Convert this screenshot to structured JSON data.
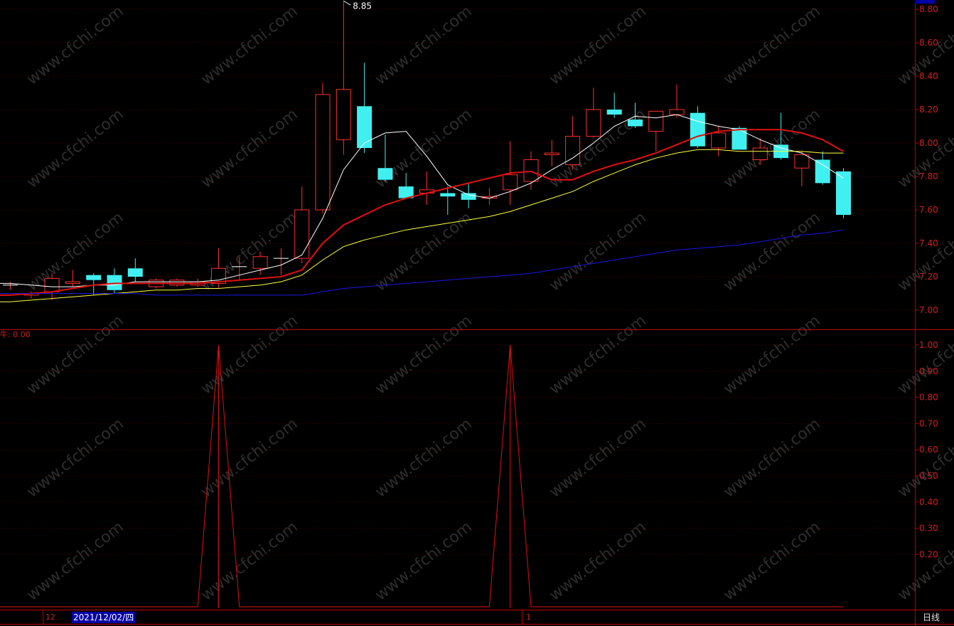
{
  "chart_data": [
    {
      "type": "candlestick",
      "panel": "price",
      "ylim": [
        7.05,
        8.86
      ],
      "y_ticks": [
        "8.80",
        "8.60",
        "8.40",
        "8.20",
        "8.00",
        "7.80",
        "7.60",
        "7.40",
        "7.20",
        "7.00"
      ],
      "high_annotation": "8.85",
      "candles": [
        {
          "o": 7.15,
          "h": 7.17,
          "l": 7.12,
          "c": 7.15
        },
        {
          "o": 7.09,
          "h": 7.11,
          "l": 7.07,
          "c": 7.1
        },
        {
          "o": 7.11,
          "h": 7.22,
          "l": 7.06,
          "c": 7.19
        },
        {
          "o": 7.16,
          "h": 7.24,
          "l": 7.14,
          "c": 7.17
        },
        {
          "o": 7.21,
          "h": 7.22,
          "l": 7.09,
          "c": 7.18
        },
        {
          "o": 7.21,
          "h": 7.25,
          "l": 7.1,
          "c": 7.12
        },
        {
          "o": 7.25,
          "h": 7.31,
          "l": 7.17,
          "c": 7.2
        },
        {
          "o": 7.14,
          "h": 7.19,
          "l": 7.13,
          "c": 7.18
        },
        {
          "o": 7.15,
          "h": 7.19,
          "l": 7.14,
          "c": 7.18
        },
        {
          "o": 7.15,
          "h": 7.19,
          "l": 7.14,
          "c": 7.17
        },
        {
          "o": 7.16,
          "h": 7.37,
          "l": 7.13,
          "c": 7.25
        },
        {
          "o": 7.26,
          "h": 7.32,
          "l": 7.18,
          "c": 7.26
        },
        {
          "o": 7.25,
          "h": 7.35,
          "l": 7.21,
          "c": 7.32
        },
        {
          "o": 7.31,
          "h": 7.37,
          "l": 7.21,
          "c": 7.31
        },
        {
          "o": 7.31,
          "h": 7.74,
          "l": 7.28,
          "c": 7.6
        },
        {
          "o": 7.6,
          "h": 8.36,
          "l": 7.58,
          "c": 8.29
        },
        {
          "o": 8.02,
          "h": 8.85,
          "l": 7.93,
          "c": 8.32
        },
        {
          "o": 8.22,
          "h": 8.48,
          "l": 7.94,
          "c": 7.97
        },
        {
          "o": 7.85,
          "h": 8.05,
          "l": 7.77,
          "c": 7.78
        },
        {
          "o": 7.74,
          "h": 7.82,
          "l": 7.67,
          "c": 7.67
        },
        {
          "o": 7.7,
          "h": 7.83,
          "l": 7.63,
          "c": 7.72
        },
        {
          "o": 7.7,
          "h": 7.74,
          "l": 7.57,
          "c": 7.68
        },
        {
          "o": 7.7,
          "h": 7.76,
          "l": 7.61,
          "c": 7.66
        },
        {
          "o": 7.67,
          "h": 7.73,
          "l": 7.63,
          "c": 7.68
        },
        {
          "o": 7.72,
          "h": 8.01,
          "l": 7.63,
          "c": 7.81
        },
        {
          "o": 7.77,
          "h": 7.95,
          "l": 7.72,
          "c": 7.9
        },
        {
          "o": 7.93,
          "h": 8.02,
          "l": 7.86,
          "c": 7.94
        },
        {
          "o": 7.87,
          "h": 8.16,
          "l": 7.84,
          "c": 8.04
        },
        {
          "o": 8.04,
          "h": 8.33,
          "l": 8.03,
          "c": 8.2
        },
        {
          "o": 8.2,
          "h": 8.3,
          "l": 8.15,
          "c": 8.17
        },
        {
          "o": 8.14,
          "h": 8.24,
          "l": 8.09,
          "c": 8.1
        },
        {
          "o": 8.07,
          "h": 8.19,
          "l": 7.95,
          "c": 8.19
        },
        {
          "o": 8.17,
          "h": 8.35,
          "l": 8.15,
          "c": 8.2
        },
        {
          "o": 8.18,
          "h": 8.22,
          "l": 7.97,
          "c": 7.98
        },
        {
          "o": 7.97,
          "h": 8.1,
          "l": 7.92,
          "c": 8.06
        },
        {
          "o": 8.09,
          "h": 8.1,
          "l": 7.96,
          "c": 7.96
        },
        {
          "o": 7.9,
          "h": 8.03,
          "l": 7.87,
          "c": 7.97
        },
        {
          "o": 7.99,
          "h": 8.18,
          "l": 7.9,
          "c": 7.91
        },
        {
          "o": 7.85,
          "h": 7.95,
          "l": 7.74,
          "c": 7.93
        },
        {
          "o": 7.9,
          "h": 7.95,
          "l": 7.75,
          "c": 7.76
        },
        {
          "o": 7.83,
          "h": 7.85,
          "l": 7.55,
          "c": 7.57
        }
      ],
      "series": [
        {
          "color": "#ffffff",
          "values": [
            7.16,
            7.15,
            7.14,
            7.14,
            7.15,
            7.15,
            7.17,
            7.17,
            7.17,
            7.17,
            7.18,
            7.21,
            7.24,
            7.27,
            7.33,
            7.55,
            7.84,
            8.0,
            8.06,
            8.07,
            7.92,
            7.75,
            7.69,
            7.67,
            7.71,
            7.76,
            7.84,
            7.91,
            8.0,
            8.1,
            8.16,
            8.15,
            8.17,
            8.13,
            8.1,
            8.08,
            8.02,
            7.97,
            7.94,
            7.87,
            7.79
          ]
        },
        {
          "color": "#e01010",
          "values": [
            7.09,
            7.1,
            7.11,
            7.13,
            7.15,
            7.16,
            7.16,
            7.16,
            7.16,
            7.16,
            7.17,
            7.18,
            7.19,
            7.2,
            7.24,
            7.4,
            7.51,
            7.57,
            7.63,
            7.67,
            7.7,
            7.73,
            7.76,
            7.79,
            7.82,
            7.83,
            7.78,
            7.78,
            7.83,
            7.87,
            7.9,
            7.94,
            7.99,
            8.04,
            8.07,
            8.08,
            8.08,
            8.08,
            8.06,
            8.02,
            7.95
          ]
        },
        {
          "color": "#ffff40",
          "values": [
            7.05,
            7.06,
            7.07,
            7.08,
            7.09,
            7.1,
            7.11,
            7.12,
            7.12,
            7.13,
            7.13,
            7.14,
            7.15,
            7.17,
            7.21,
            7.3,
            7.38,
            7.42,
            7.45,
            7.48,
            7.5,
            7.52,
            7.54,
            7.56,
            7.59,
            7.63,
            7.67,
            7.71,
            7.77,
            7.82,
            7.87,
            7.91,
            7.94,
            7.96,
            7.96,
            7.95,
            7.95,
            7.95,
            7.95,
            7.94,
            7.94
          ]
        },
        {
          "color": "#1818e0",
          "values": [
            7.1,
            7.1,
            7.1,
            7.1,
            7.1,
            7.1,
            7.1,
            7.09,
            7.09,
            7.09,
            7.09,
            7.09,
            7.09,
            7.09,
            7.09,
            7.11,
            7.13,
            7.14,
            7.15,
            7.16,
            7.17,
            7.18,
            7.19,
            7.2,
            7.21,
            7.22,
            7.24,
            7.26,
            7.28,
            7.3,
            7.32,
            7.34,
            7.36,
            7.37,
            7.38,
            7.39,
            7.41,
            7.43,
            7.45,
            7.46,
            7.48
          ]
        }
      ]
    },
    {
      "type": "line",
      "panel": "indicator",
      "title": "牛: 0.00",
      "ylim": [
        0,
        1.0
      ],
      "y_ticks": [
        "1.00",
        "0.90",
        "0.80",
        "0.70",
        "0.60",
        "0.50",
        "0.40",
        "0.30",
        "0.20"
      ],
      "spikes": [
        10,
        24
      ],
      "values": [
        0,
        0,
        0,
        0,
        0,
        0,
        0,
        0,
        0,
        0,
        1,
        0,
        0,
        0,
        0,
        0,
        0,
        0,
        0,
        0,
        0,
        0,
        0,
        0,
        1,
        0,
        0,
        0,
        0,
        0,
        0,
        0,
        0,
        0,
        0,
        0,
        0,
        0,
        0,
        0,
        0
      ]
    }
  ],
  "xaxis": {
    "labels": [
      {
        "text": "12",
        "index": 2
      },
      {
        "text": "1",
        "index": 25
      }
    ],
    "cursor_date": "2021/12/02/四",
    "period": "日线"
  },
  "watermark": "www.cfchi.com"
}
